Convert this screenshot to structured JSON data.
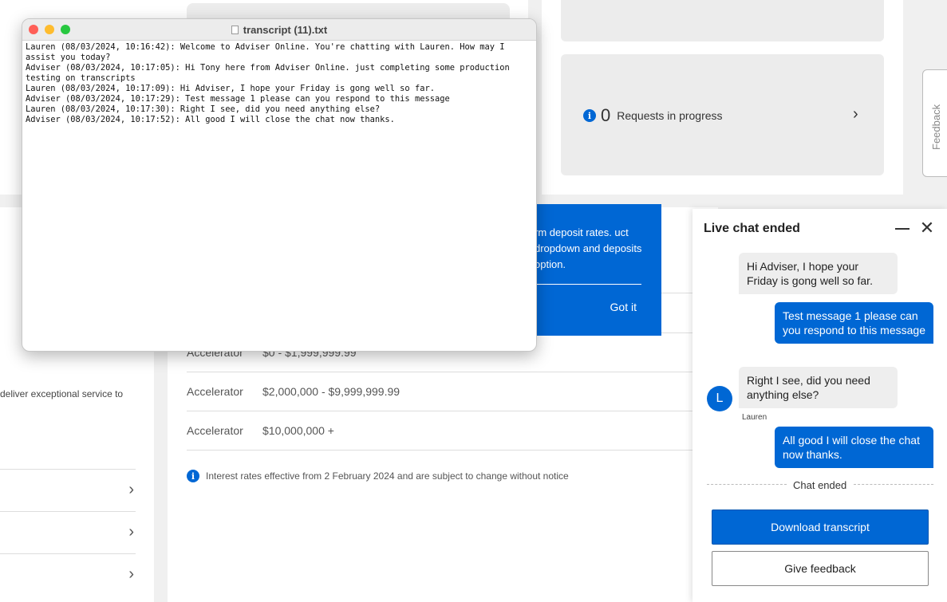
{
  "background": {
    "requests": {
      "count": "0",
      "label": "Requests in progress"
    },
    "left_text": "deliver exceptional service to",
    "rates": [
      {
        "name": "Accelerator",
        "range": "$0 - $1,999,999.99"
      },
      {
        "name": "Accelerator",
        "range": "$2,000,000 - $9,999,999.99"
      },
      {
        "name": "Accelerator",
        "range": "$10,000,000 +"
      }
    ],
    "rate_note": "Interest rates effective from 2 February 2024 and are subject to change without notice",
    "popover": {
      "text": "rm deposit rates. uct dropdown and deposits option.",
      "button": "Got it"
    },
    "feedback_tab": "Feedback"
  },
  "transcript_window": {
    "title": "transcript (11).txt",
    "lines": [
      "Lauren (08/03/2024, 10:16:42): Welcome to Adviser Online. You're chatting with Lauren. How may I assist you today?",
      "Adviser (08/03/2024, 10:17:05): Hi Tony here from Adviser Online. just completing some production testing on transcripts",
      "Lauren (08/03/2024, 10:17:09): Hi Adviser, I hope your Friday is gong well so far.",
      "Adviser (08/03/2024, 10:17:29): Test message 1 please can you respond to this message",
      "Lauren (08/03/2024, 10:17:30): Right I see, did you need anything else?",
      "Adviser (08/03/2024, 10:17:52): All good I will close the chat now thanks."
    ]
  },
  "chat": {
    "title": "Live chat ended",
    "messages": [
      {
        "from": "agent",
        "text": "Hi Adviser, I hope your Friday is gong well so far."
      },
      {
        "from": "user",
        "text": "Test message 1 please can you respond to this message"
      },
      {
        "from": "agent",
        "text": "Right I see, did you need anything else?"
      },
      {
        "from": "user",
        "text": "All good I will close the chat now thanks."
      }
    ],
    "agent_initial": "L",
    "agent_name": "Lauren",
    "ended_label": "Chat ended",
    "download_label": "Download transcript",
    "feedback_label": "Give feedback"
  },
  "colors": {
    "accent": "#0067d4"
  }
}
